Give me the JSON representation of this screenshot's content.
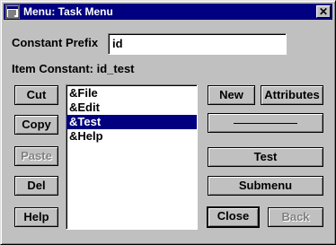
{
  "window": {
    "title": "Menu: Task Menu",
    "close_glyph": "✕"
  },
  "form": {
    "constant_prefix_label": "Constant Prefix",
    "constant_prefix_value": "id",
    "item_constant_label": "Item Constant: id_test"
  },
  "buttons": {
    "cut": "Cut",
    "copy": "Copy",
    "paste": "Paste",
    "del": "Del",
    "help": "Help",
    "new": "New",
    "attributes": "Attributes",
    "test": "Test",
    "submenu": "Submenu",
    "close": "Close",
    "back": "Back"
  },
  "menu_items": [
    {
      "label": "&File",
      "selected": false
    },
    {
      "label": "&Edit",
      "selected": false
    },
    {
      "label": "&Test",
      "selected": true
    },
    {
      "label": "&Help",
      "selected": false
    }
  ],
  "colors": {
    "titlebar": "#000080",
    "selection": "#000080",
    "face": "#c0c0c0"
  }
}
